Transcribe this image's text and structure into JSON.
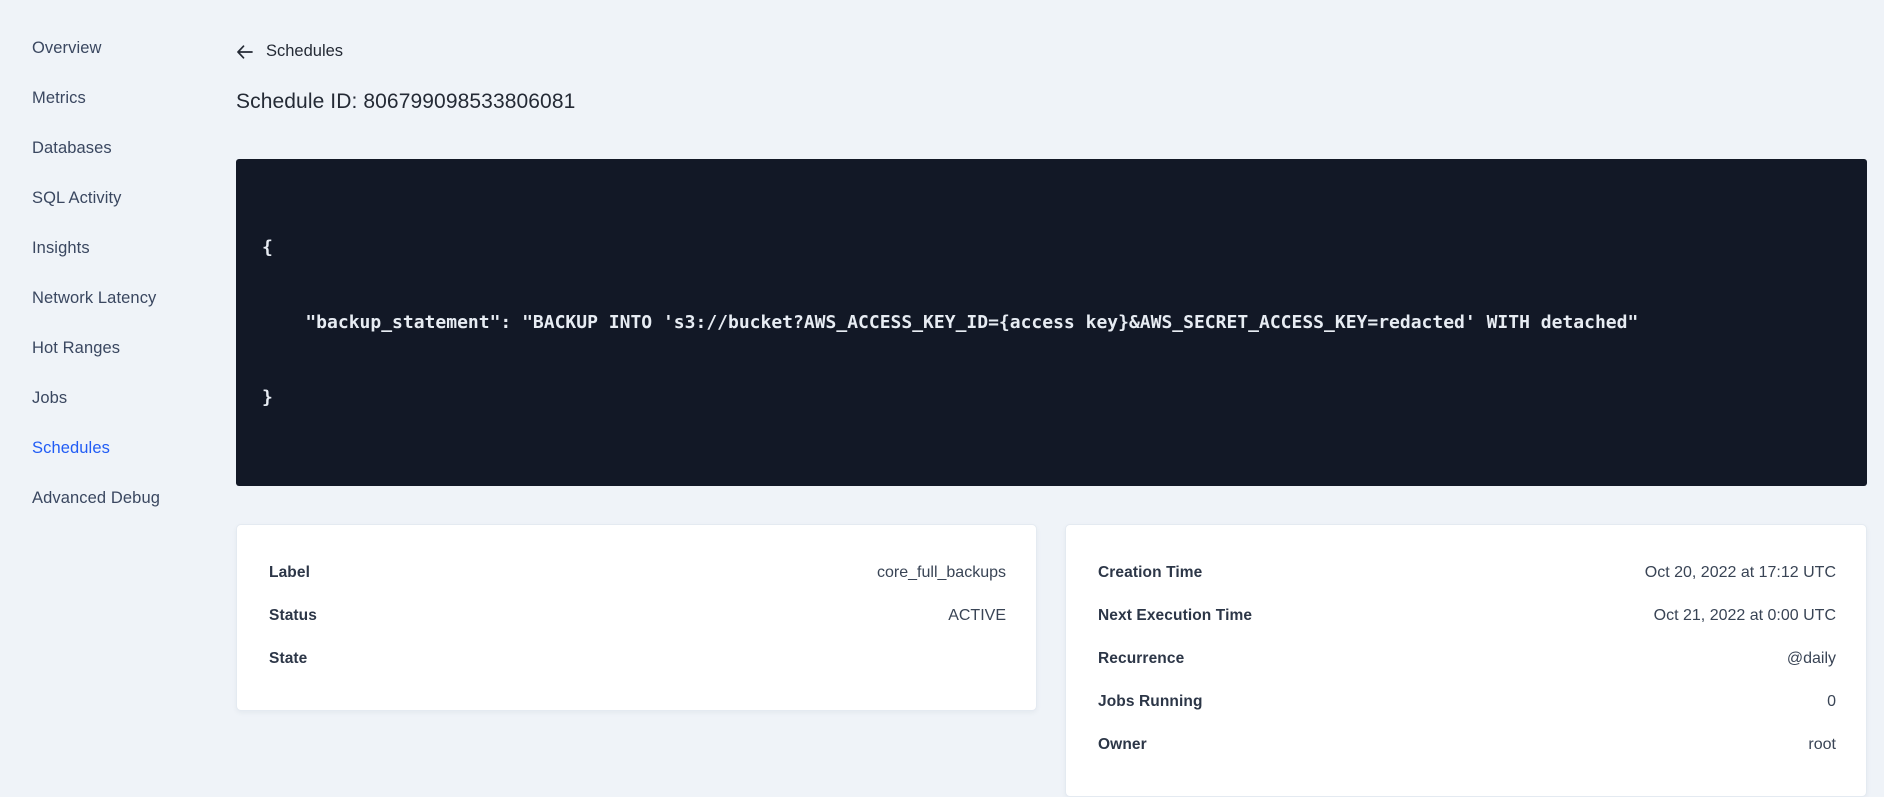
{
  "sidebar": {
    "items": [
      {
        "label": "Overview"
      },
      {
        "label": "Metrics"
      },
      {
        "label": "Databases"
      },
      {
        "label": "SQL Activity"
      },
      {
        "label": "Insights"
      },
      {
        "label": "Network Latency"
      },
      {
        "label": "Hot Ranges"
      },
      {
        "label": "Jobs"
      },
      {
        "label": "Schedules"
      },
      {
        "label": "Advanced Debug"
      }
    ]
  },
  "header": {
    "back_label": "Schedules",
    "back_icon": "arrow-left-icon",
    "title": "Schedule ID: 806799098533806081"
  },
  "code_block": {
    "lines": [
      "{",
      "    \"backup_statement\": \"BACKUP INTO 's3://bucket?AWS_ACCESS_KEY_ID={access key}&AWS_SECRET_ACCESS_KEY=redacted' WITH detached\"",
      "}"
    ]
  },
  "details_left": {
    "rows": [
      {
        "label": "Label",
        "value": "core_full_backups"
      },
      {
        "label": "Status",
        "value": "ACTIVE"
      },
      {
        "label": "State",
        "value": ""
      }
    ]
  },
  "details_right": {
    "rows": [
      {
        "label": "Creation Time",
        "value": "Oct 20, 2022 at 17:12 UTC"
      },
      {
        "label": "Next Execution Time",
        "value": "Oct 21, 2022 at 0:00 UTC"
      },
      {
        "label": "Recurrence",
        "value": "@daily"
      },
      {
        "label": "Jobs Running",
        "value": "0"
      },
      {
        "label": "Owner",
        "value": "root"
      }
    ]
  },
  "colors": {
    "accent_blue": "#215cf5",
    "code_background": "#121826",
    "page_background": "#eff3f8"
  }
}
